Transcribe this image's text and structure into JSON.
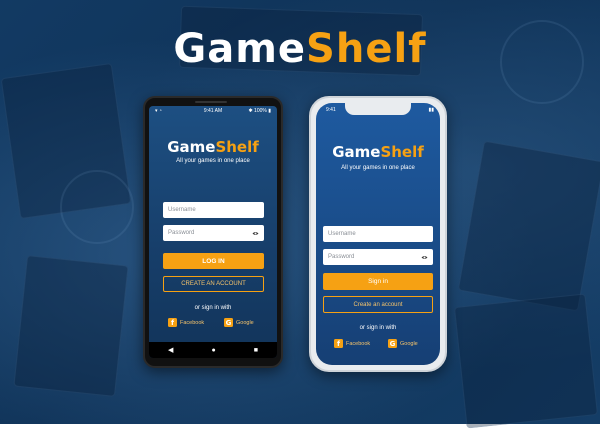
{
  "brand": {
    "part1": "Game",
    "part2": "Shelf"
  },
  "android": {
    "status_time": "9:41 AM",
    "status_battery": "100%",
    "title_part1": "Game",
    "title_part2": "Shelf",
    "tagline": "All your games in one place",
    "username_placeholder": "Username",
    "password_placeholder": "Password",
    "login_label": "LOG IN",
    "create_label": "CREATE AN ACCOUNT",
    "or_label": "or sign in with",
    "facebook_label": "Facebook",
    "google_label": "Google",
    "nav_back": "◀",
    "nav_home": "●",
    "nav_recent": "■"
  },
  "iphone": {
    "status_time": "9:41",
    "title_part1": "Game",
    "title_part2": "Shelf",
    "tagline": "All your games in one place",
    "username_placeholder": "Username",
    "password_placeholder": "Password",
    "login_label": "Sign in",
    "create_label": "Create an account",
    "or_label": "or sign in with",
    "facebook_label": "Facebook",
    "google_label": "Google"
  },
  "colors": {
    "accent": "#f6a113",
    "background": "#123a63",
    "white": "#ffffff"
  }
}
